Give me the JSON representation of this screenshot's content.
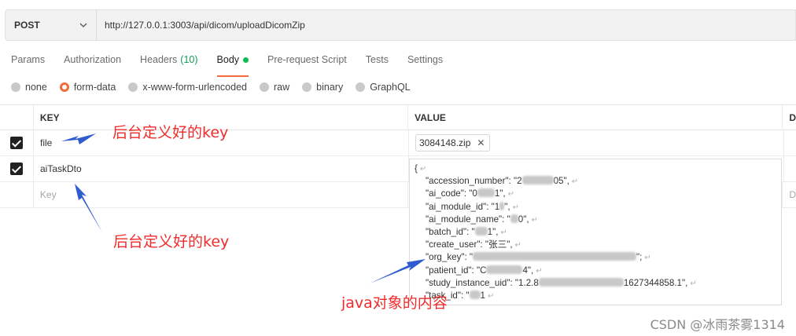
{
  "request": {
    "method": "POST",
    "url": "http://127.0.0.1:3003/api/dicom/uploadDicomZip"
  },
  "tabs": [
    {
      "label": "Params"
    },
    {
      "label": "Authorization"
    },
    {
      "label": "Headers",
      "count": "(10)"
    },
    {
      "label": "Body"
    },
    {
      "label": "Pre-request Script"
    },
    {
      "label": "Tests"
    },
    {
      "label": "Settings"
    }
  ],
  "body_types": [
    "none",
    "form-data",
    "x-www-form-urlencoded",
    "raw",
    "binary",
    "GraphQL"
  ],
  "selected_body_type": "form-data",
  "table": {
    "headers": {
      "key": "KEY",
      "value": "VALUE",
      "desc": "D"
    },
    "rows": [
      {
        "key": "file",
        "value": "3084148.zip"
      },
      {
        "key": "aiTaskDto"
      }
    ],
    "new_key_placeholder": "Key",
    "new_desc_placeholder": "D"
  },
  "json_value": {
    "open": "{",
    "lines": [
      {
        "k": "\"accession_number\": \"2",
        "tail": "05\","
      },
      {
        "k": "\"ai_code\": \"0",
        "tail": "1\","
      },
      {
        "k": "\"ai_module_id\": \"1",
        "tail": "\","
      },
      {
        "k": "\"ai_module_name\": \"",
        "tail": "0\","
      },
      {
        "k": "\"batch_id\": \"",
        "tail": "1\","
      },
      {
        "k": "\"create_user\": \"张三\","
      },
      {
        "k": "\"org_key\": \"",
        "tail": "\";"
      },
      {
        "k": "\"patient_id\": \"C",
        "tail": "4\","
      },
      {
        "k": "\"study_instance_uid\": \"1.2.8",
        "tail": "1627344858.1\","
      },
      {
        "k": "\"task_id\": \"",
        "tail": "1"
      }
    ]
  },
  "annotations": {
    "key_label_1": "后台定义好的key",
    "key_label_2": "后台定义好的key",
    "java_label": "java对象的内容"
  },
  "watermark": "CSDN @冰雨茶雾1314",
  "colors": {
    "accent": "#f26b3a",
    "body_dot": "#0cbb52",
    "annotation_red": "#ef2b2b",
    "annotation_arrow": "#2f5ccf"
  }
}
